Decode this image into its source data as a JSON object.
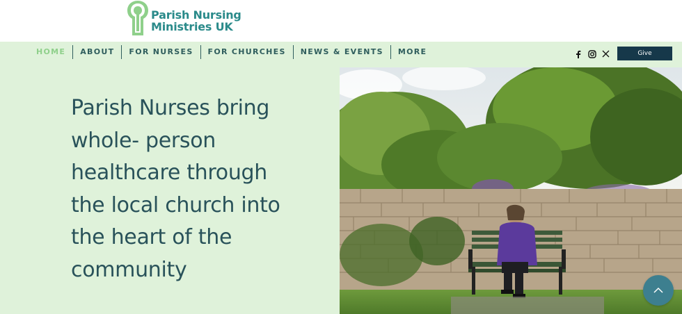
{
  "header": {
    "logo_line1": "Parish Nursing",
    "logo_line2": "Ministries UK"
  },
  "nav": {
    "items": [
      {
        "label": "HOME",
        "active": true
      },
      {
        "label": "ABOUT"
      },
      {
        "label": "FOR NURSES"
      },
      {
        "label": "FOR CHURCHES"
      },
      {
        "label": "NEWS & EVENTS"
      },
      {
        "label": "MORE"
      }
    ]
  },
  "social": {
    "icons": [
      "facebook-icon",
      "instagram-icon",
      "x-icon"
    ]
  },
  "give_label": "Give",
  "hero": {
    "heading": "Parish Nurses bring whole- person healthcare through the local church into the heart of the community"
  },
  "colors": {
    "brand_teal": "#2a8a8a",
    "logo_green": "#8fd08b",
    "nav_bg": "#dff2da",
    "give_bg": "#16384a",
    "text_dark": "#29525a"
  }
}
